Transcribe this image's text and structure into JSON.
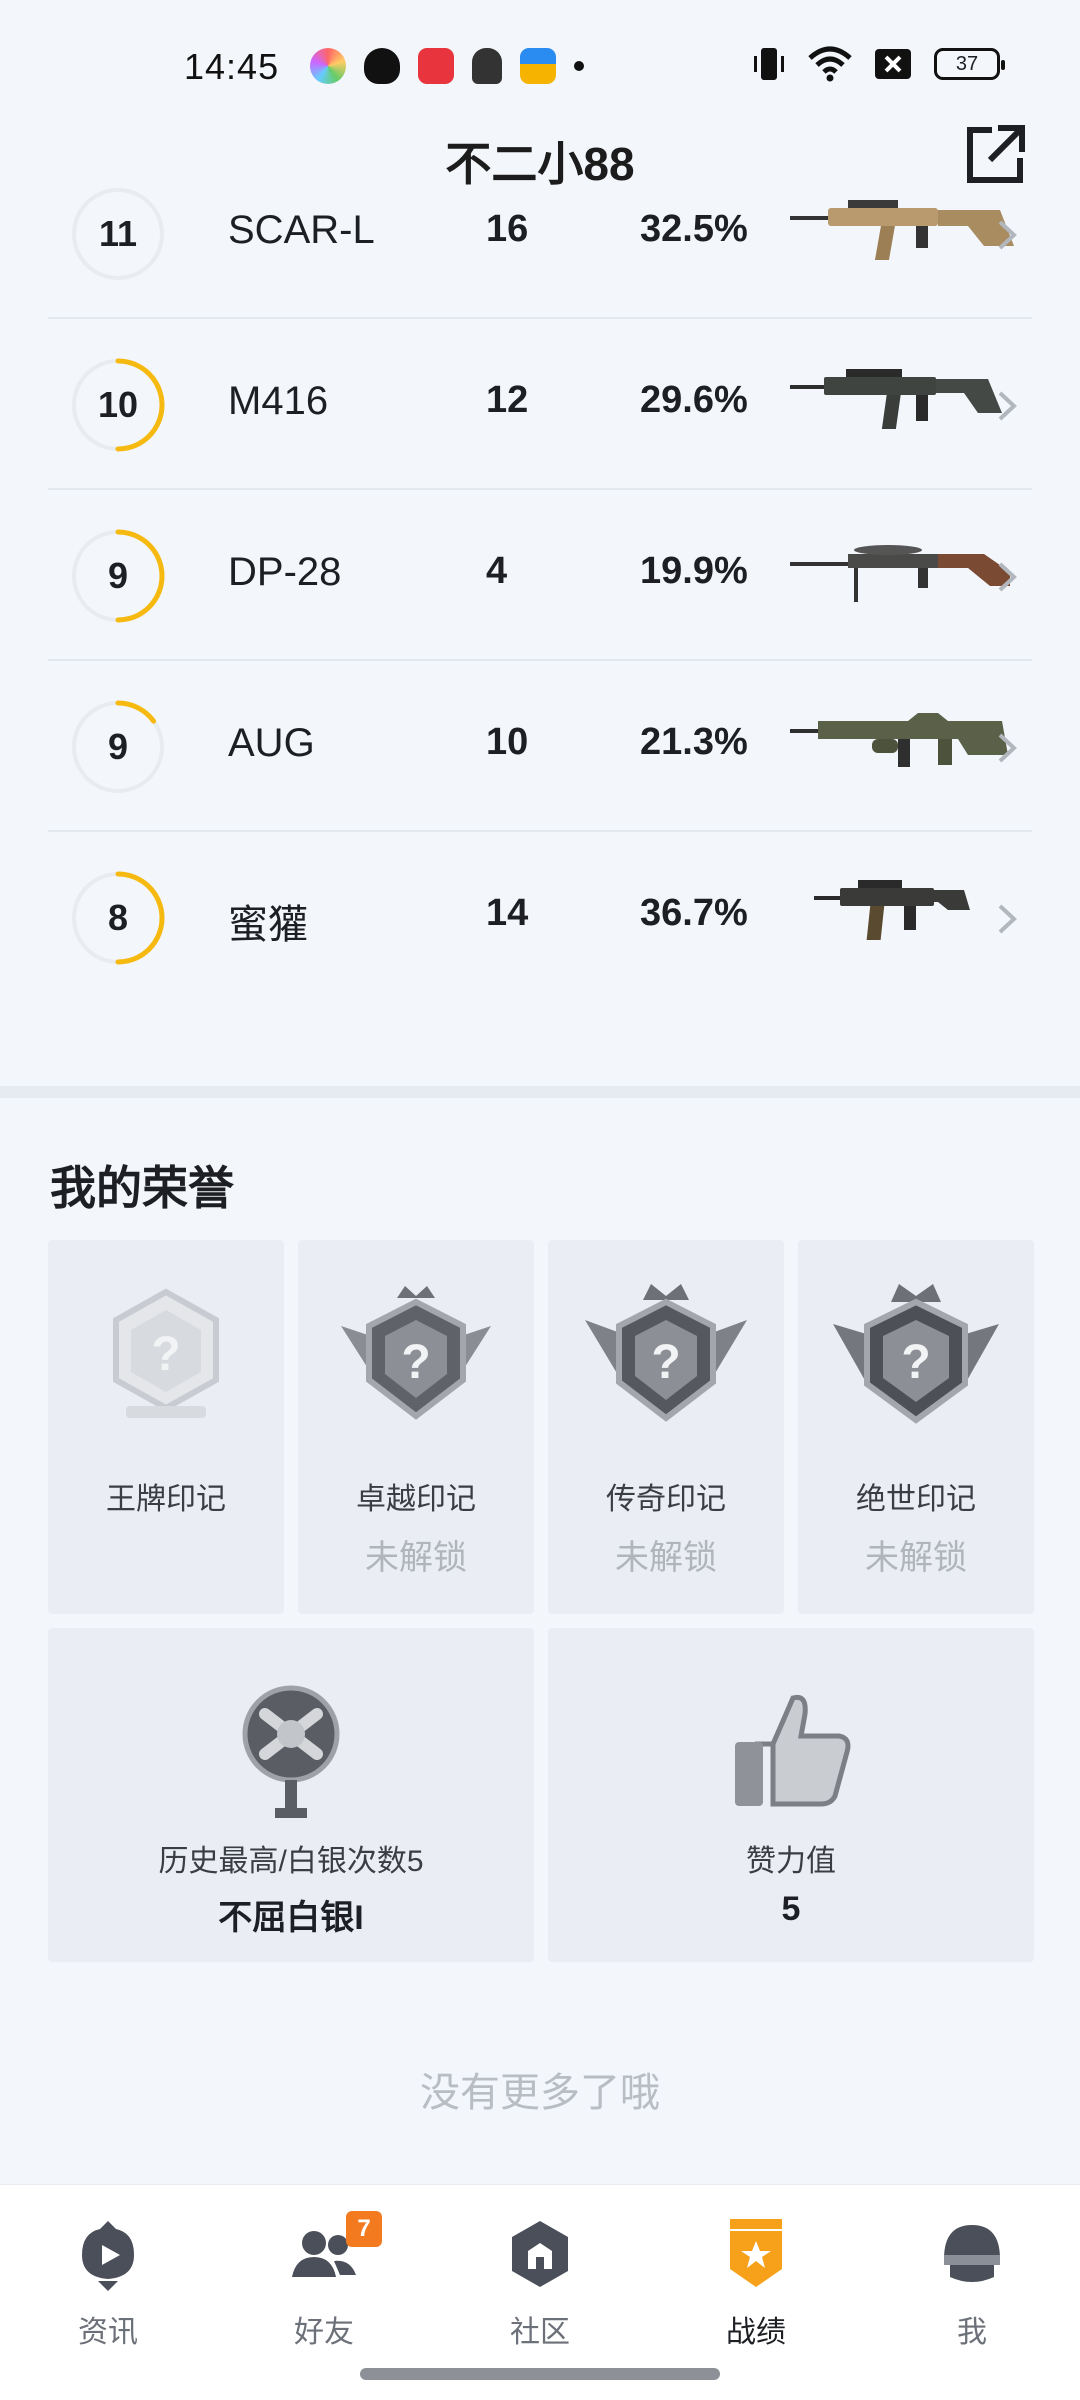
{
  "status_bar": {
    "time": "14:45",
    "battery": "37"
  },
  "header": {
    "title": "不二小88",
    "share_icon": "share-external-icon"
  },
  "weapons": [
    {
      "level": "11",
      "name": "SCAR-L",
      "count": "16",
      "rate": "32.5%",
      "progress": 0
    },
    {
      "level": "10",
      "name": "M416",
      "count": "12",
      "rate": "29.6%",
      "progress": 0.5
    },
    {
      "level": "9",
      "name": "DP-28",
      "count": "4",
      "rate": "19.9%",
      "progress": 0.5
    },
    {
      "level": "9",
      "name": "AUG",
      "count": "10",
      "rate": "21.3%",
      "progress": 0.15
    },
    {
      "level": "8",
      "name": "蜜獾",
      "count": "14",
      "rate": "36.7%",
      "progress": 0.5
    }
  ],
  "colors": {
    "progress": "#f5b90f",
    "ring_bg": "#e8ebf0",
    "accent": "#f37a1f"
  },
  "honors": {
    "title": "我的荣誉",
    "marks": [
      {
        "label": "王牌印记",
        "status": ""
      },
      {
        "label": "卓越印记",
        "status": "未解锁"
      },
      {
        "label": "传奇印记",
        "status": "未解锁"
      },
      {
        "label": "绝世印记",
        "status": "未解锁"
      }
    ],
    "rank": {
      "label": "历史最高/白银次数5",
      "value": "不屈白银I"
    },
    "likes": {
      "label": "赞力值",
      "value": "5"
    }
  },
  "footer_note": "没有更多了哦",
  "nav": [
    {
      "label": "资讯",
      "icon": "news-icon",
      "badge": ""
    },
    {
      "label": "好友",
      "icon": "friends-icon",
      "badge": "7"
    },
    {
      "label": "社区",
      "icon": "community-icon",
      "badge": ""
    },
    {
      "label": "战绩",
      "icon": "stats-icon",
      "badge": ""
    },
    {
      "label": "我",
      "icon": "profile-helmet-icon",
      "badge": ""
    }
  ]
}
